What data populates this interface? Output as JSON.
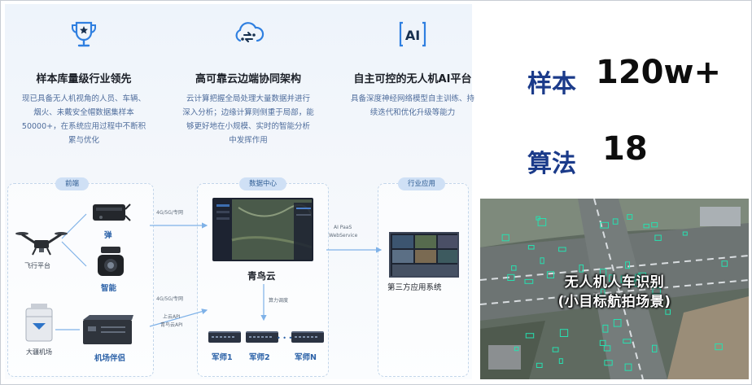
{
  "features": [
    {
      "icon": "trophy-icon",
      "title": "样本库量级行业领先",
      "lines": [
        "现已具备无人机视角的人员、车辆、",
        "烟火、未戴安全帽数据集样本",
        "50000+，在系统应用过程中不断积",
        "累与优化"
      ]
    },
    {
      "icon": "cloud-edge-icon",
      "title": "高可靠云边端协同架构",
      "lines": [
        "云计算把握全局处理大量数据并进行",
        "深入分析；边缘计算则侧重于局部，能",
        "够更好地在小规模、实时的智能分析",
        "中发挥作用"
      ]
    },
    {
      "icon": "ai-icon",
      "title": "自主可控的无人机AI平台",
      "lines": [
        "具备深度神经网络模型自主训练、持",
        "续迭代和优化升级等能力"
      ]
    }
  ],
  "ai_icon_text": "AI",
  "diagram": {
    "front_tag": "前端",
    "datacenter_tag": "数据中心",
    "industry_tag": "行业应用",
    "flight_platform": "飞行平台",
    "pod": "弹",
    "smart_pod": "智能",
    "hangar": "大疆机场",
    "hangar_companion": "机场伴侣",
    "link_top": "4G/5G/专网",
    "link_bottom": "4G/5G/专网",
    "upload_api": "上云API",
    "qingniao_api": "青鸟云API",
    "ai_paas": "AI PaaS",
    "webservice": "WebService",
    "cloud_name": "青鸟云",
    "compute_dispatch": "算力调度",
    "servers": [
      "军师1",
      "军师2",
      "军师N"
    ],
    "dots": "• • •",
    "third_party": "第三方应用系统"
  },
  "stats": [
    {
      "label": "样本",
      "value": "120w+"
    },
    {
      "label": "算法",
      "value": "18"
    }
  ],
  "photo": {
    "caption_line1": "无人机人车识别",
    "caption_line2": "(小目标航拍场景)"
  },
  "colors": {
    "accent_blue": "#2c62a8",
    "stat_blue": "#1b3b8a",
    "detect_green": "#27e0b0"
  }
}
